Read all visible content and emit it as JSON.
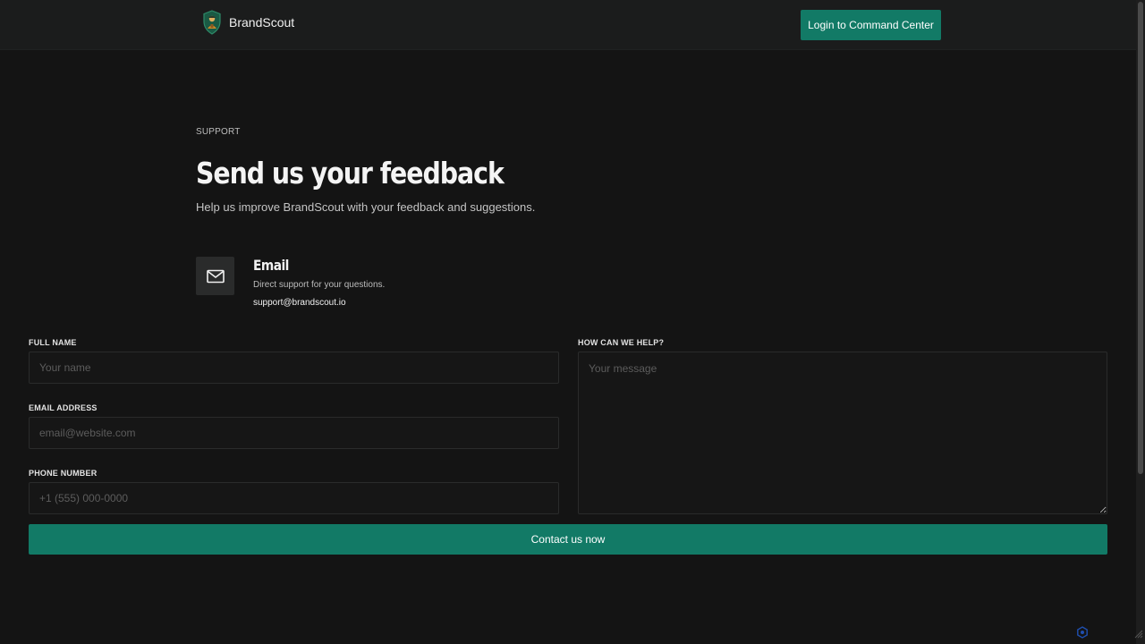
{
  "header": {
    "brand_name": "BrandScout",
    "login_label": "Login to Command Center"
  },
  "hero": {
    "eyebrow": "SUPPORT",
    "title": "Send us your feedback",
    "subtitle": "Help us improve BrandScout with your feedback and suggestions."
  },
  "contact": {
    "title": "Email",
    "description": "Direct support for your questions.",
    "email": "support@brandscout.io",
    "icon": "mail-icon"
  },
  "form": {
    "full_name": {
      "label": "FULL NAME",
      "placeholder": "Your name",
      "value": ""
    },
    "email": {
      "label": "EMAIL ADDRESS",
      "placeholder": "email@website.com",
      "value": ""
    },
    "phone": {
      "label": "PHONE NUMBER",
      "placeholder": "+1 (555) 000-0000",
      "value": ""
    },
    "message": {
      "label": "HOW CAN WE HELP?",
      "placeholder": "Your message",
      "value": ""
    },
    "submit_label": "Contact us now"
  },
  "colors": {
    "background": "#141414",
    "header_bg": "#1b1c1c",
    "accent": "#127a66",
    "field_border": "#2a2b2b"
  }
}
